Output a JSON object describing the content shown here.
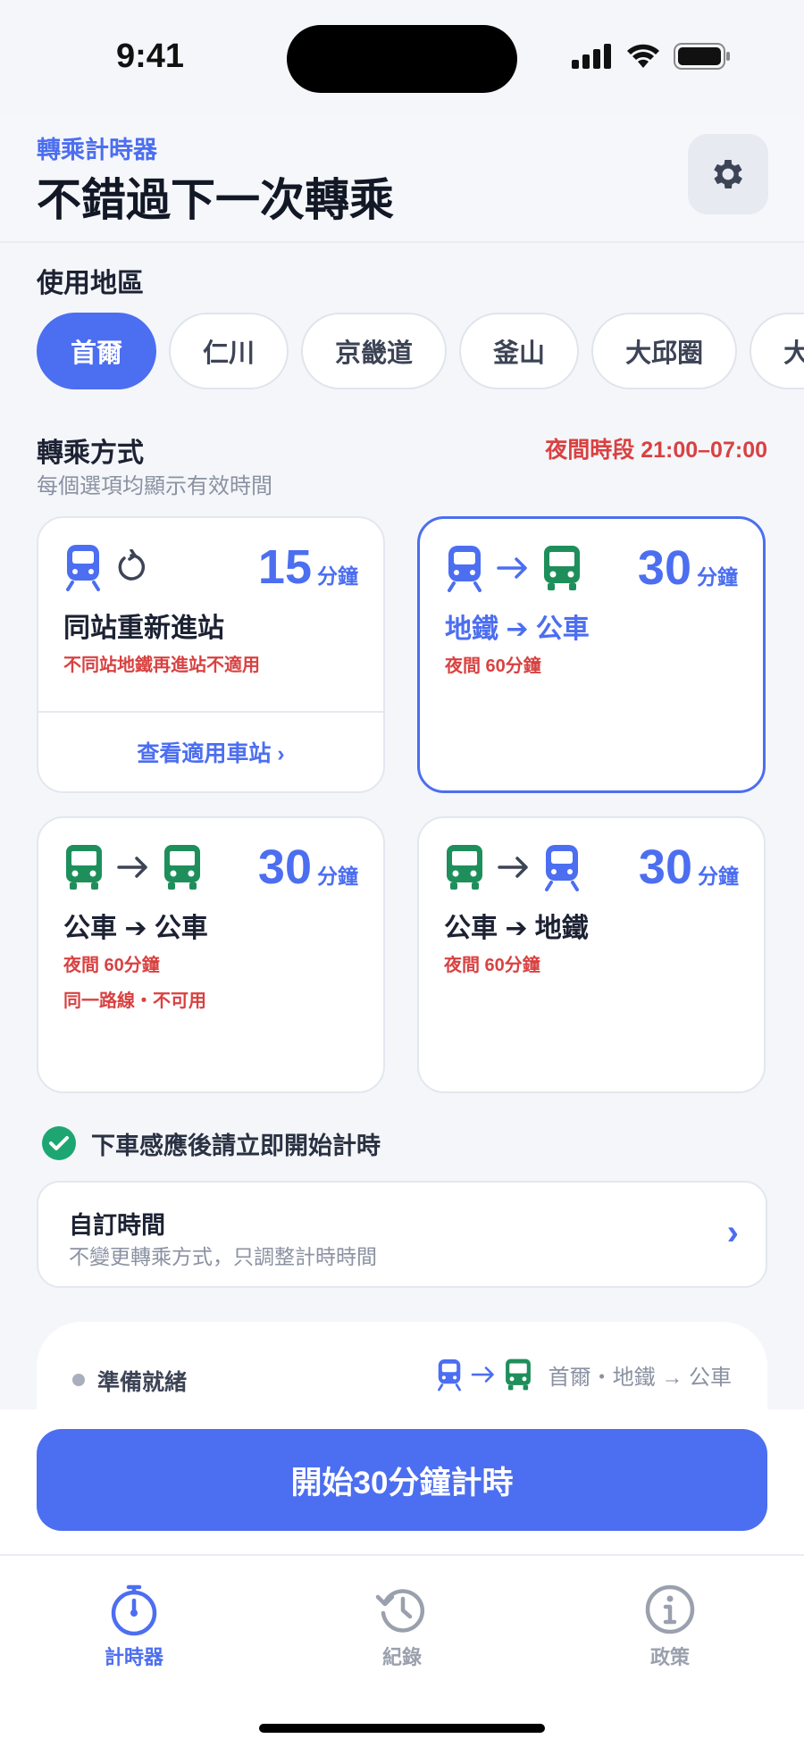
{
  "status_bar": {
    "time": "9:41"
  },
  "header": {
    "app_name": "轉乘計時器",
    "headline": "不錯過下一次轉乘",
    "settings_icon": "gear-icon"
  },
  "region": {
    "title": "使用地區",
    "chips": [
      "首爾",
      "仁川",
      "京畿道",
      "釜山",
      "大邱圈",
      "大"
    ],
    "selected": "首爾"
  },
  "transfer": {
    "title": "轉乘方式",
    "subtitle": "每個選項均顯示有效時間",
    "night_label": "夜間時段 21:00–07:00",
    "cards": [
      {
        "icons": [
          "subway-icon",
          "restart-icon"
        ],
        "minutes": "15",
        "unit": "分鐘",
        "title": "同站重新進站",
        "note1": "不同站地鐵再進站不適用",
        "note2": "",
        "footer": "查看適用車站 ›",
        "selected": false
      },
      {
        "icons": [
          "subway-icon",
          "arrow-right-icon",
          "bus-icon"
        ],
        "minutes": "30",
        "unit": "分鐘",
        "title": "地鐵 ➔ 公車",
        "note1": "夜間 60分鐘",
        "note2": "",
        "footer": "",
        "selected": true
      },
      {
        "icons": [
          "bus-icon",
          "arrow-right-icon",
          "bus-icon"
        ],
        "minutes": "30",
        "unit": "分鐘",
        "title": "公車 ➔ 公車",
        "note1": "夜間 60分鐘",
        "note2": "同一路線・不可用",
        "footer": "",
        "selected": false
      },
      {
        "icons": [
          "bus-icon",
          "arrow-right-icon",
          "subway-icon"
        ],
        "minutes": "30",
        "unit": "分鐘",
        "title": "公車 ➔ 地鐵",
        "note1": "夜間 60分鐘",
        "note2": "",
        "footer": "",
        "selected": false
      }
    ]
  },
  "notice": "下車感應後請立即開始計時",
  "custom_time": {
    "title": "自訂時間",
    "subtitle": "不變更轉乘方式，只調整計時時間",
    "chevron": "›"
  },
  "ready": {
    "label": "準備就緒",
    "route": "首爾・地鐵 → 公車"
  },
  "cta": {
    "label": "開始30分鐘計時"
  },
  "tabs": [
    {
      "label": "計時器",
      "icon": "stopwatch-icon",
      "active": true
    },
    {
      "label": "紀錄",
      "icon": "history-icon",
      "active": false
    },
    {
      "label": "政策",
      "icon": "info-icon",
      "active": false
    }
  ],
  "colors": {
    "accent": "#4c6ef0",
    "bus_green": "#1e8f5b",
    "warning_red": "#d94141"
  }
}
